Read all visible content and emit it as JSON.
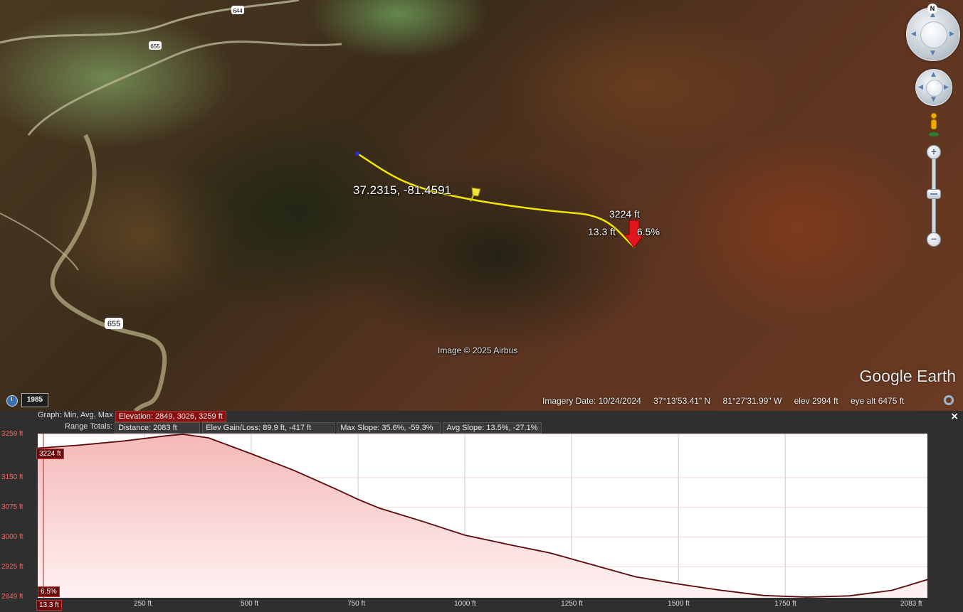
{
  "map": {
    "coordinate_label": "37.2315, -81.4591",
    "pointer_elevation": "3224 ft",
    "pointer_distance": "13.3 ft",
    "pointer_slope": "6.5%",
    "copyright": "Image © 2025 Airbus",
    "logo": "Google Earth",
    "road_labels": [
      "644",
      "655",
      "655"
    ],
    "historical_year": "1985",
    "north_label": "N"
  },
  "status": {
    "imagery_date": "Imagery Date: 10/24/2024",
    "lat": "37°13'53.41\" N",
    "lon": "81°27'31.99\" W",
    "elev": "elev  2994 ft",
    "eye_alt": "eye alt   6475 ft"
  },
  "profile": {
    "graph_label": "Graph: Min, Avg, Max",
    "elevation_stat": "Elevation: 2849, 3026, 3259 ft",
    "range_label": "Range Totals:",
    "distance_stat": "Distance: 2083 ft",
    "gain_loss_stat": "Elev Gain/Loss: 89.9 ft, -417 ft",
    "max_slope_stat": "Max Slope: 35.6%, -59.3%",
    "avg_slope_stat": "Avg Slope: 13.5%, -27.1%",
    "close_label": "×",
    "cursor_elev_tag": "3224 ft",
    "cursor_slope_tag": "6.5%",
    "cursor_dist_tag": "13.3 ft",
    "end_dist_label": "2083 ft"
  },
  "chart_data": {
    "type": "area",
    "title": "",
    "xlabel": "",
    "ylabel": "",
    "xlim": [
      0,
      2083
    ],
    "ylim": [
      2849,
      3259
    ],
    "y_ticks": [
      2849,
      2925,
      3000,
      3075,
      3150,
      3259
    ],
    "y_tick_labels": [
      "2849 ft",
      "2925 ft",
      "3000 ft",
      "3075 ft",
      "3150 ft",
      "3259 ft"
    ],
    "x_ticks": [
      250,
      500,
      750,
      1000,
      1250,
      1500,
      1750
    ],
    "x_tick_labels": [
      "250 ft",
      "500 ft",
      "750 ft",
      "1000 ft",
      "1250 ft",
      "1500 ft",
      "1750 ft"
    ],
    "grid": true,
    "colors": {
      "fill_top": "#f4b8b8",
      "fill_bottom": "#fff2f2",
      "line": "#5a0a0a",
      "grid": "#c8c8c8"
    },
    "x": [
      0,
      100,
      200,
      300,
      340,
      400,
      500,
      600,
      700,
      750,
      800,
      900,
      1000,
      1100,
      1200,
      1300,
      1400,
      1500,
      1600,
      1700,
      1800,
      1900,
      2000,
      2083
    ],
    "y": [
      3224,
      3232,
      3242,
      3255,
      3259,
      3250,
      3210,
      3168,
      3120,
      3095,
      3073,
      3040,
      3005,
      2982,
      2960,
      2930,
      2900,
      2882,
      2866,
      2853,
      2849,
      2852,
      2866,
      2893
    ]
  }
}
